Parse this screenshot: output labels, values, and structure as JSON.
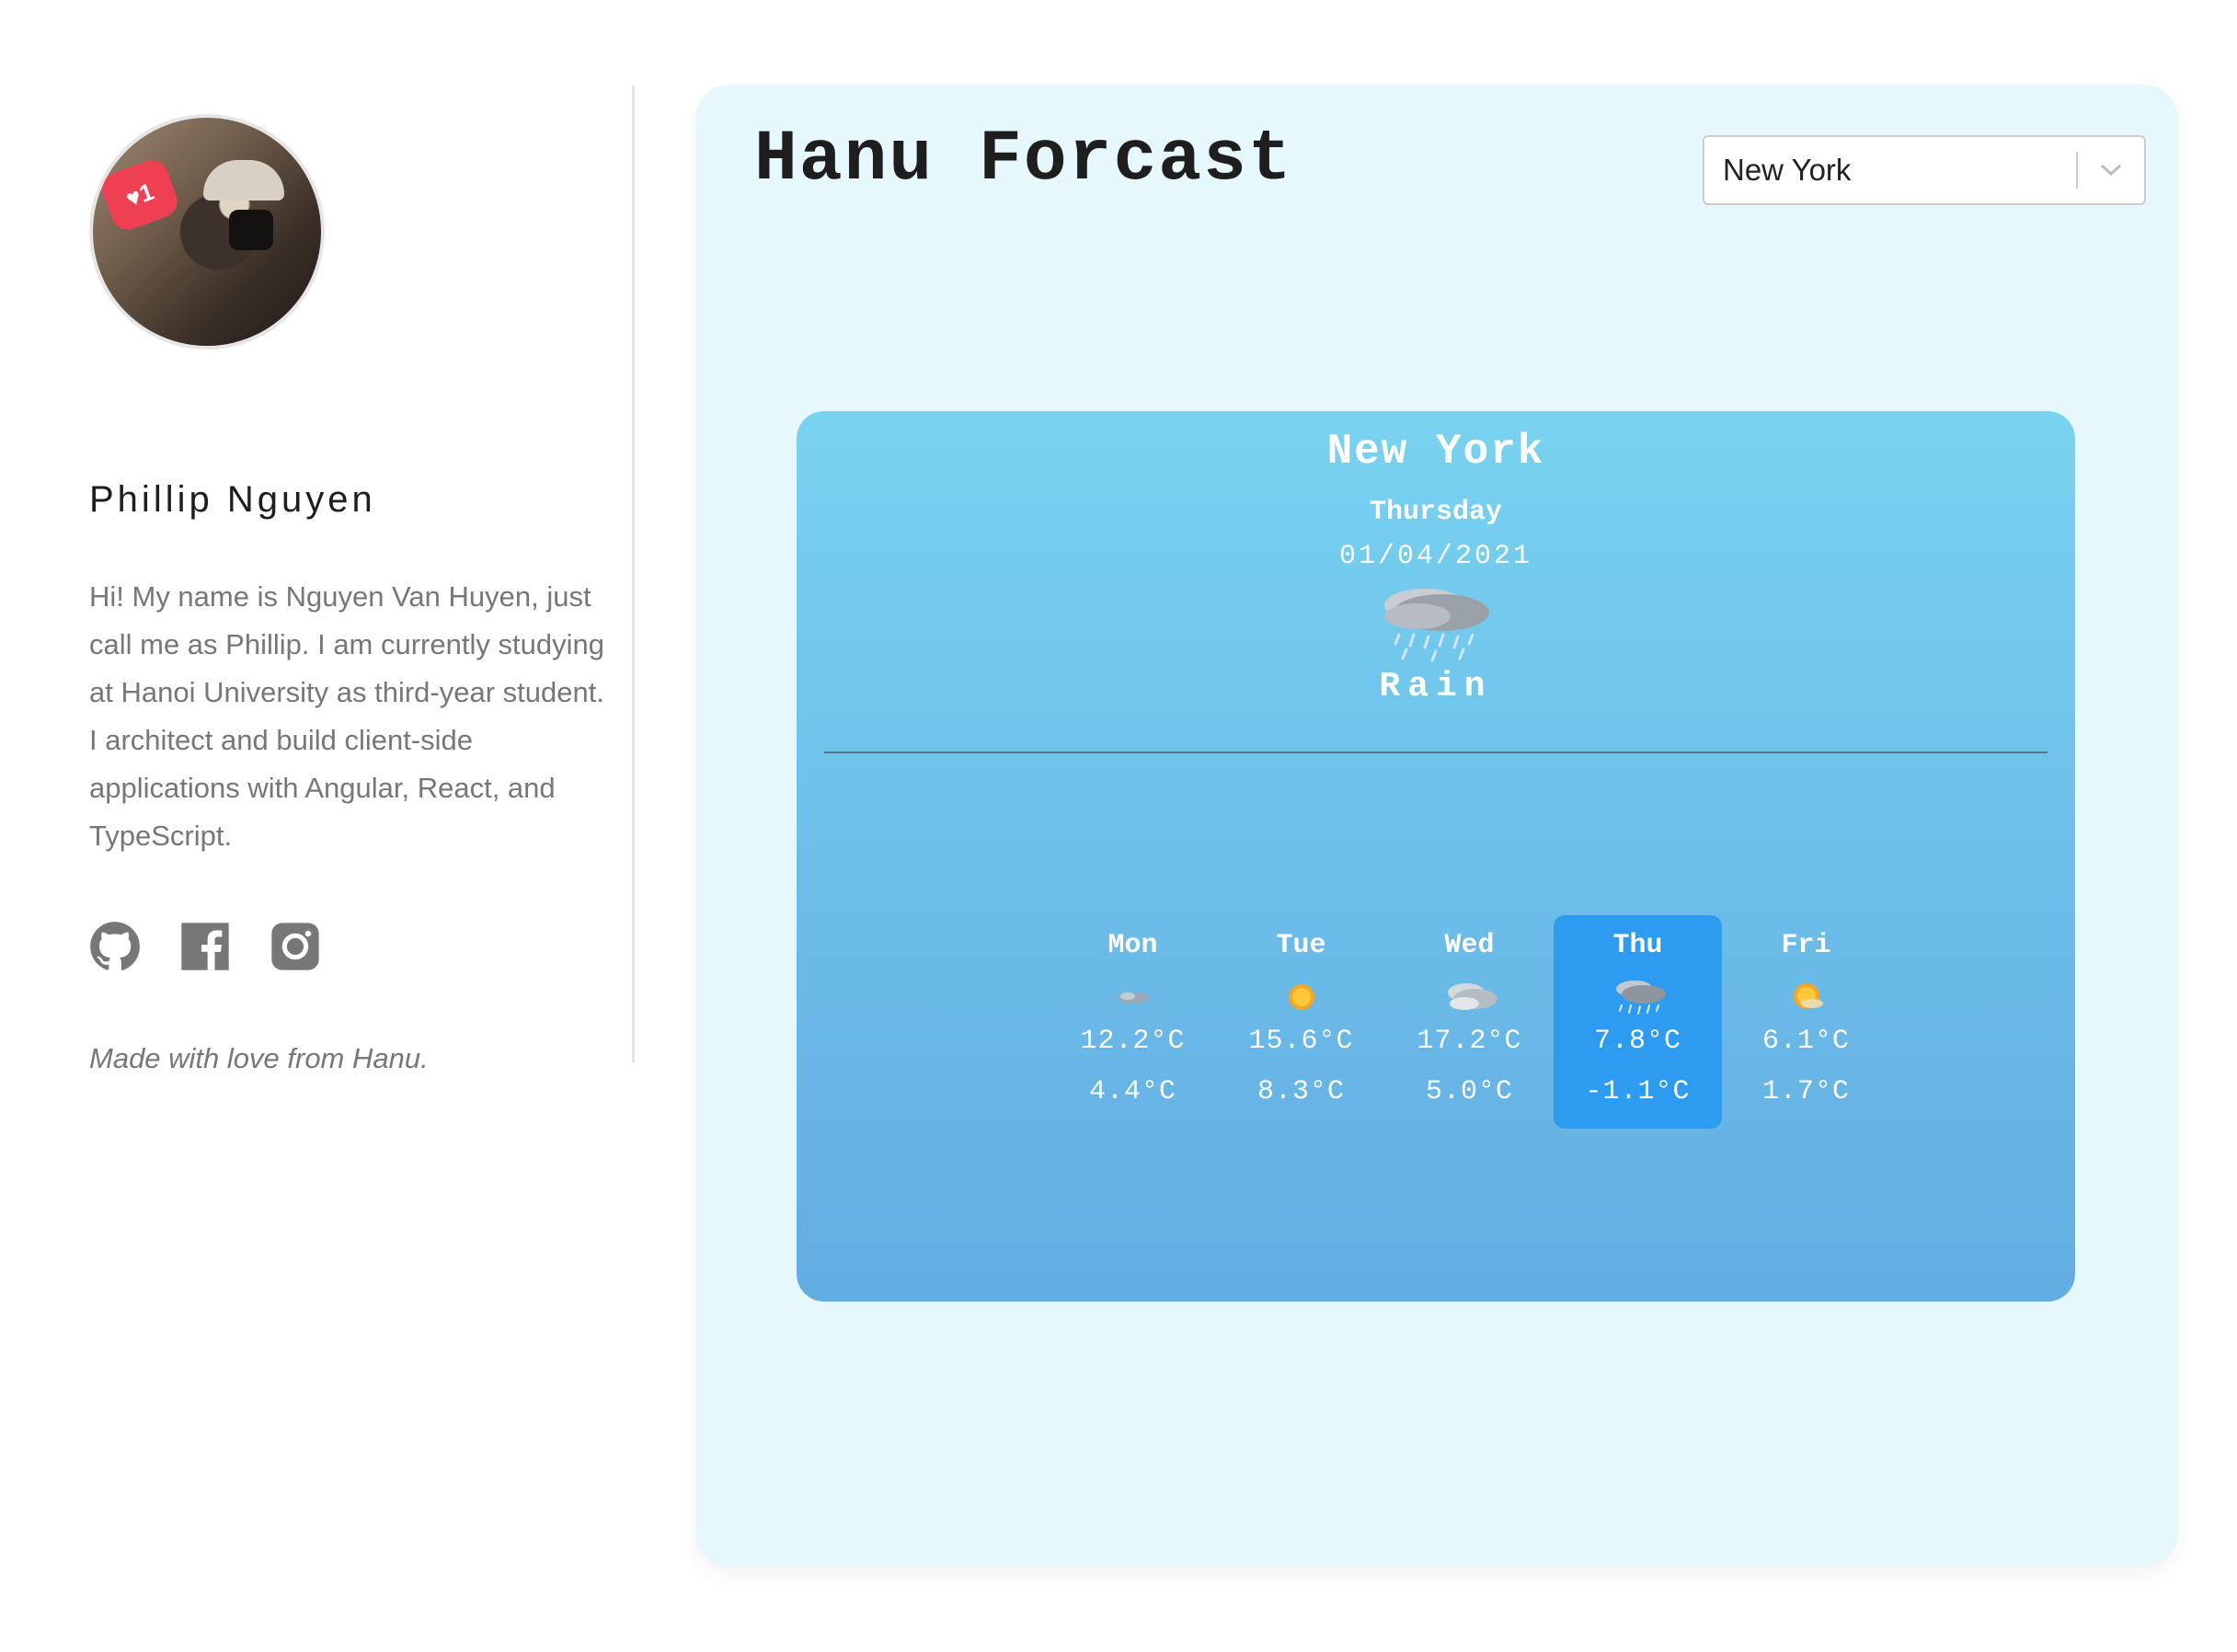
{
  "profile": {
    "name": "Phillip Nguyen",
    "bio": "Hi! My name is Nguyen Van Huyen, just call me as Phillip. I am currently studying at Hanoi University as third-year student. I architect and build client-side applications with Angular, React, and TypeScript.",
    "like_count": "1",
    "socials": [
      {
        "name": "github-icon"
      },
      {
        "name": "facebook-icon"
      },
      {
        "name": "instagram-icon"
      }
    ],
    "footer": "Made with love from Hanu."
  },
  "app": {
    "title": "Hanu Forcast",
    "city_select": {
      "value": "New York",
      "icon": "chevron-down-icon"
    }
  },
  "current": {
    "city": "New York",
    "weekday": "Thursday",
    "date": "01/04/2021",
    "condition": "Rain",
    "icon": "rain-icon"
  },
  "forecast": [
    {
      "day": "Mon",
      "high": "12.2°C",
      "low": "4.4°C",
      "icon": "cloudy-icon",
      "active": false
    },
    {
      "day": "Tue",
      "high": "15.6°C",
      "low": "8.3°C",
      "icon": "sun-icon",
      "active": false
    },
    {
      "day": "Wed",
      "high": "17.2°C",
      "low": "5.0°C",
      "icon": "overcast-icon",
      "active": false
    },
    {
      "day": "Thu",
      "high": "7.8°C",
      "low": "-1.1°C",
      "icon": "rain-icon",
      "active": true
    },
    {
      "day": "Fri",
      "high": "6.1°C",
      "low": "1.7°C",
      "icon": "sun-cloud-icon",
      "active": false
    }
  ],
  "colors": {
    "panel_bg": "#e7f8fc",
    "card_top": "#78d3ef",
    "card_bottom": "#62ade2",
    "active_day": "#2d9cf0",
    "social_icon": "#777777"
  }
}
